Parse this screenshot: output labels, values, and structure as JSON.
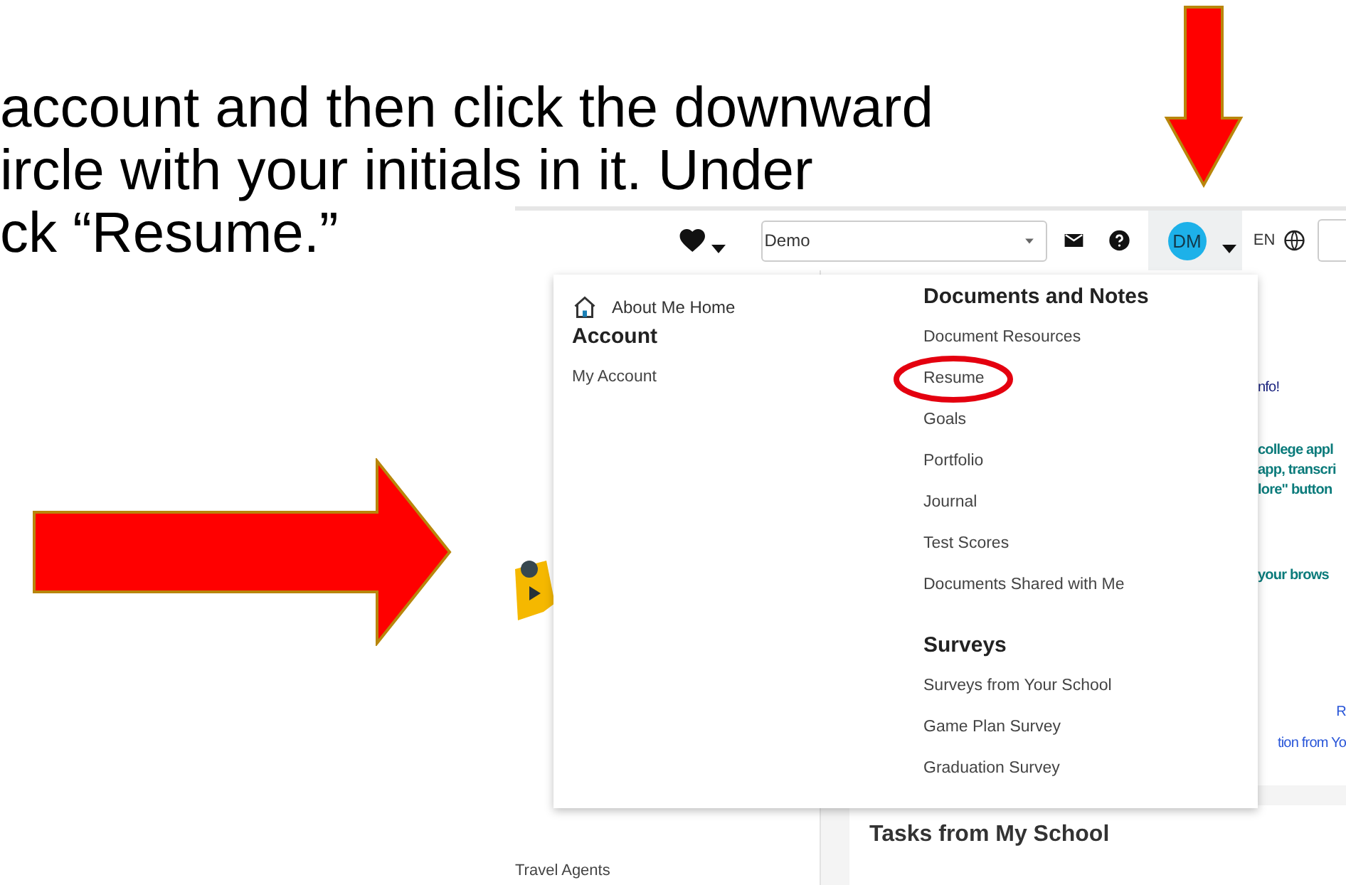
{
  "instruction_lines": [
    "account and then click the downward",
    "ircle with your initials in it. Under",
    "ck “Resume.”"
  ],
  "topbar": {
    "select_value": "Demo",
    "avatar_initials": "DM",
    "language": "EN"
  },
  "menu": {
    "home_link": "About Me Home",
    "left_sections": [
      {
        "heading": "Account",
        "items": [
          {
            "label": "My Account",
            "circled": false
          }
        ]
      }
    ],
    "right_sections": [
      {
        "heading": "Documents and Notes",
        "items": [
          {
            "label": "Document Resources",
            "circled": false
          },
          {
            "label": "Resume",
            "circled": true
          },
          {
            "label": "Goals",
            "circled": false
          },
          {
            "label": "Portfolio",
            "circled": false
          },
          {
            "label": "Journal",
            "circled": false
          },
          {
            "label": "Test Scores",
            "circled": false
          },
          {
            "label": "Documents Shared with Me",
            "circled": false
          }
        ]
      },
      {
        "heading": "Surveys",
        "items": [
          {
            "label": "Surveys from Your School",
            "circled": false
          },
          {
            "label": "Game Plan Survey",
            "circled": false
          },
          {
            "label": "Graduation Survey",
            "circled": false
          }
        ]
      }
    ]
  },
  "background": {
    "right_texts": [
      {
        "text": "nfo!",
        "kind": "title"
      },
      {
        "text": "college appl",
        "kind": "teal"
      },
      {
        "text": "app, transcri",
        "kind": "teal"
      },
      {
        "text": "lore\" button",
        "kind": "teal"
      },
      {
        "text": "your brows",
        "kind": "teal"
      },
      {
        "text": "R",
        "kind": "link"
      },
      {
        "text": "tion from Yo",
        "kind": "link"
      }
    ],
    "tasks_heading": "Tasks from My School",
    "sidebar_text": "Travel Agents"
  }
}
